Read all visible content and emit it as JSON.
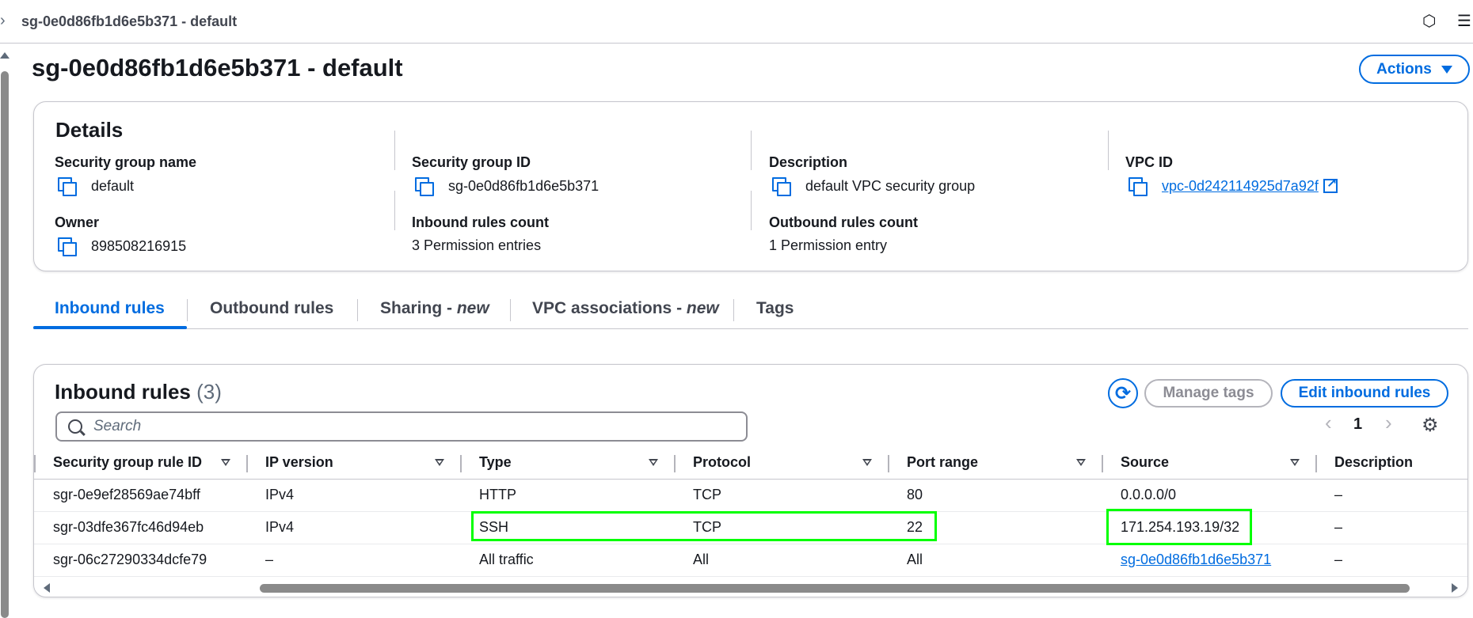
{
  "breadcrumb": {
    "current": "sg-0e0d86fb1d6e5b371 - default"
  },
  "header": {
    "title": "sg-0e0d86fb1d6e5b371 - default",
    "actions_label": "Actions"
  },
  "details": {
    "heading": "Details",
    "security_group_name": {
      "label": "Security group name",
      "value": "default"
    },
    "security_group_id": {
      "label": "Security group ID",
      "value": "sg-0e0d86fb1d6e5b371"
    },
    "description": {
      "label": "Description",
      "value": "default VPC security group"
    },
    "vpc_id": {
      "label": "VPC ID",
      "value": "vpc-0d242114925d7a92f"
    },
    "owner": {
      "label": "Owner",
      "value": "898508216915"
    },
    "inbound_count": {
      "label": "Inbound rules count",
      "value": "3 Permission entries"
    },
    "outbound_count": {
      "label": "Outbound rules count",
      "value": "1 Permission entry"
    }
  },
  "tabs": [
    {
      "label": "Inbound rules",
      "suffix": ""
    },
    {
      "label": "Outbound rules",
      "suffix": ""
    },
    {
      "label": "Sharing - ",
      "suffix": "new"
    },
    {
      "label": "VPC associations - ",
      "suffix": "new"
    },
    {
      "label": "Tags",
      "suffix": ""
    }
  ],
  "inbound": {
    "title": "Inbound rules",
    "count": "(3)",
    "manage_tags_label": "Manage tags",
    "edit_label": "Edit inbound rules",
    "search_placeholder": "Search",
    "page_number": "1",
    "columns": [
      "Security group rule ID",
      "IP version",
      "Type",
      "Protocol",
      "Port range",
      "Source",
      "Description"
    ],
    "rows": [
      [
        "sgr-0e9ef28569ae74bff",
        "IPv4",
        "HTTP",
        "TCP",
        "80",
        "0.0.0.0/0",
        "–"
      ],
      [
        "sgr-03dfe367fc46d94eb",
        "IPv4",
        "SSH",
        "TCP",
        "22",
        "171.254.193.19/32",
        "–"
      ],
      [
        "sgr-06c27290334dcfe79",
        "–",
        "All traffic",
        "All",
        "All",
        "sg-0e0d86fb1d6e5b371",
        "–"
      ]
    ]
  },
  "colors": {
    "accent": "#006ce0",
    "highlight": "#00ff00",
    "border": "#c6c6cd"
  }
}
